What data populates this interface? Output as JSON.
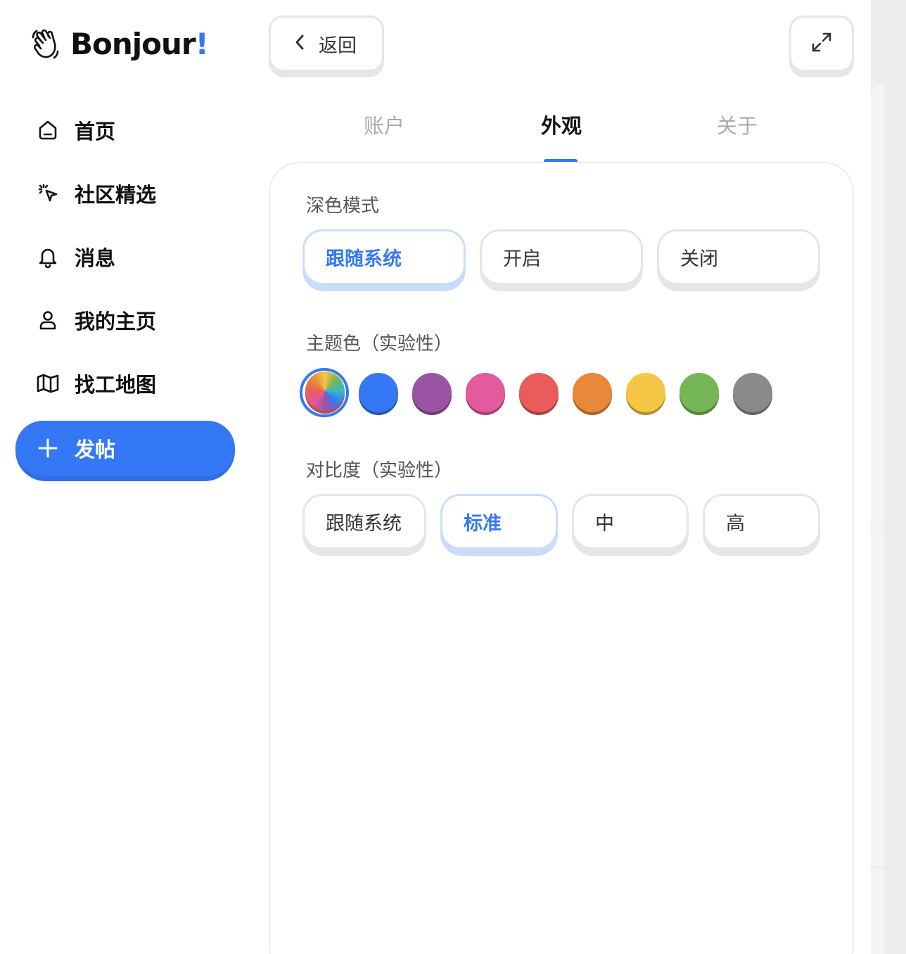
{
  "app": {
    "name": "Bonjour",
    "name_suffix": "!"
  },
  "sidebar": {
    "items": [
      {
        "label": "首页",
        "icon": "home-icon"
      },
      {
        "label": "社区精选",
        "icon": "sparkle-cursor-icon"
      },
      {
        "label": "消息",
        "icon": "bell-icon"
      },
      {
        "label": "我的主页",
        "icon": "user-icon"
      },
      {
        "label": "找工地图",
        "icon": "map-icon"
      }
    ],
    "post_button": {
      "label": "发帖",
      "icon": "plus-icon"
    }
  },
  "header": {
    "back_label": "返回",
    "back_icon": "chevron-left-icon",
    "expand_icon": "expand-icon"
  },
  "tabs": [
    {
      "label": "账户",
      "active": false
    },
    {
      "label": "外观",
      "active": true
    },
    {
      "label": "关于",
      "active": false
    }
  ],
  "settings": {
    "dark_mode": {
      "title": "深色模式",
      "options": [
        "跟随系统",
        "开启",
        "关闭"
      ],
      "selected": "跟随系统"
    },
    "theme_color": {
      "title": "主题色（实验性）",
      "colors": [
        "rainbow",
        "#3478f6",
        "#9b54a3",
        "#e35a9d",
        "#ea5b5b",
        "#e8893a",
        "#f5c644",
        "#74b656",
        "#8a8a8a"
      ],
      "selected": "rainbow"
    },
    "contrast": {
      "title": "对比度（实验性）",
      "options": [
        "跟随系统",
        "标准",
        "中",
        "高"
      ],
      "selected": "标准"
    }
  },
  "colors": {
    "accent": "#3478f6",
    "accent_light": "#c9ddfb"
  }
}
